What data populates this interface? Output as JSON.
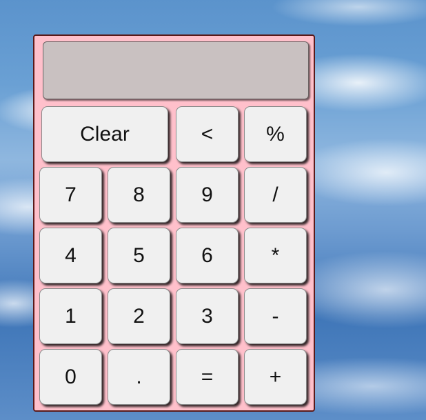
{
  "calculator": {
    "display_value": "",
    "colors": {
      "body": "#ffc0cb",
      "display": "#c9c1c1",
      "button": "#f0f0f0"
    },
    "buttons": {
      "clear": "Clear",
      "backspace": "<",
      "percent": "%",
      "seven": "7",
      "eight": "8",
      "nine": "9",
      "divide": "/",
      "four": "4",
      "five": "5",
      "six": "6",
      "multiply": "*",
      "one": "1",
      "two": "2",
      "three": "3",
      "subtract": "-",
      "zero": "0",
      "decimal": ".",
      "equals": "=",
      "add": "+"
    }
  }
}
